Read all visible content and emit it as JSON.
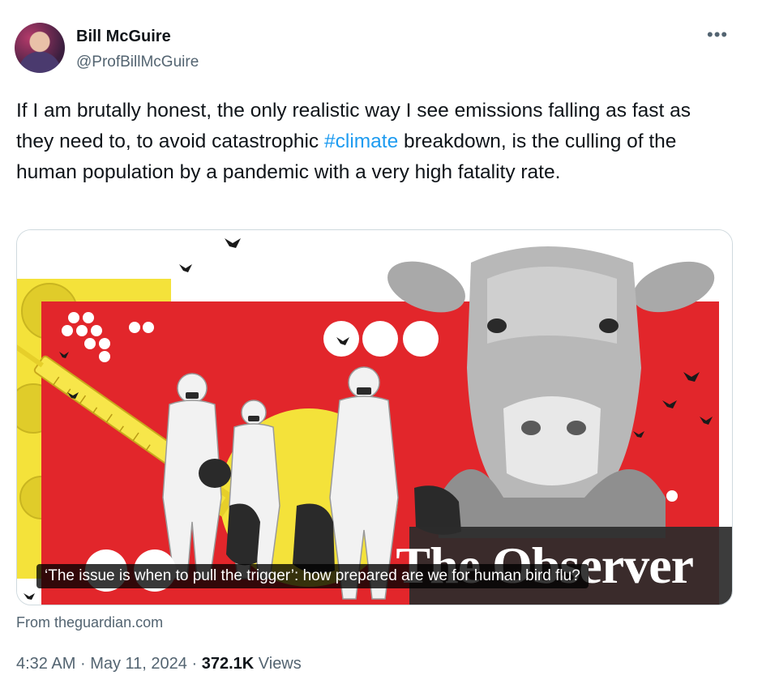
{
  "author": {
    "display_name": "Bill McGuire",
    "handle": "@ProfBillMcGuire"
  },
  "more_icon": "more-horizontal-icon",
  "tweet": {
    "text_before": "If I am brutally honest, the only realistic way I see emissions falling as fast as they need to, to avoid catastrophic ",
    "hashtag": "#climate",
    "text_after": " breakdown, is the culling of the human population by a pandemic with a very high fatality rate."
  },
  "card": {
    "masthead": "The Observer",
    "caption": "‘The issue is when to pull the trigger’: how prepared are we for human bird flu?",
    "source": "From theguardian.com"
  },
  "meta": {
    "time": "4:32 AM",
    "date": "May 11, 2024",
    "views_count": "372.1K",
    "views_label": "Views",
    "separator": "·"
  },
  "colors": {
    "hashtag": "#1d9bf0",
    "secondary_text": "#536471",
    "card_red": "#e2262b",
    "card_yellow": "#f4e23a"
  }
}
